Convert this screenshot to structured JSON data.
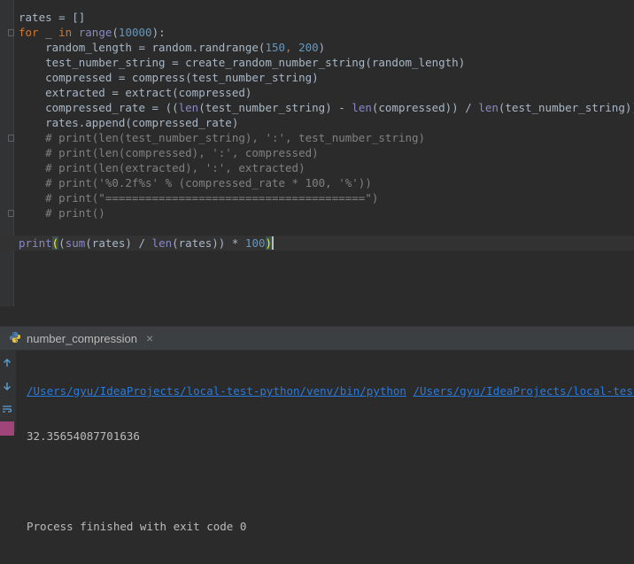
{
  "editor": {
    "lines": [
      [
        {
          "t": "rates = []",
          "c": ""
        }
      ],
      [
        {
          "t": "for",
          "c": "kw"
        },
        {
          "t": " _ ",
          "c": ""
        },
        {
          "t": "in",
          "c": "kw"
        },
        {
          "t": " ",
          "c": ""
        },
        {
          "t": "range",
          "c": "bi"
        },
        {
          "t": "(",
          "c": ""
        },
        {
          "t": "10000",
          "c": "num"
        },
        {
          "t": "):",
          "c": ""
        }
      ],
      [
        {
          "t": "    random_length = random.randrange(",
          "c": ""
        },
        {
          "t": "150",
          "c": "num"
        },
        {
          "t": ", ",
          "c": "kw"
        },
        {
          "t": "200",
          "c": "num"
        },
        {
          "t": ")",
          "c": ""
        }
      ],
      [
        {
          "t": "    test_number_string = create_random_number_string(random_length)",
          "c": ""
        }
      ],
      [
        {
          "t": "    compressed = compress(test_number_string)",
          "c": ""
        }
      ],
      [
        {
          "t": "    extracted = extract(compressed)",
          "c": ""
        }
      ],
      [
        {
          "t": "    compressed_rate = ((",
          "c": ""
        },
        {
          "t": "len",
          "c": "bi"
        },
        {
          "t": "(test_number_string) - ",
          "c": ""
        },
        {
          "t": "len",
          "c": "bi"
        },
        {
          "t": "(compressed)) / ",
          "c": ""
        },
        {
          "t": "len",
          "c": "bi"
        },
        {
          "t": "(test_number_string))",
          "c": ""
        }
      ],
      [
        {
          "t": "    rates.append(compressed_rate)",
          "c": ""
        }
      ],
      [
        {
          "t": "    # print(len(test_number_string), ':', test_number_string)",
          "c": "cm"
        }
      ],
      [
        {
          "t": "    # print(len(compressed), ':', compressed)",
          "c": "cm"
        }
      ],
      [
        {
          "t": "    # print(len(extracted), ':', extracted)",
          "c": "cm"
        }
      ],
      [
        {
          "t": "    # print('%0.2f%s' % (compressed_rate * 100, '%'))",
          "c": "cm"
        }
      ],
      [
        {
          "t": "    # print(\"=======================================\")",
          "c": "cm"
        }
      ],
      [
        {
          "t": "    # print()",
          "c": "cm"
        }
      ],
      [],
      [
        {
          "t": "print",
          "c": "bi"
        },
        {
          "t": "(",
          "c": "paren-hl"
        },
        {
          "t": "(",
          "c": ""
        },
        {
          "t": "sum",
          "c": "bi"
        },
        {
          "t": "(rates) / ",
          "c": ""
        },
        {
          "t": "len",
          "c": "bi"
        },
        {
          "t": "(rates)) * ",
          "c": ""
        },
        {
          "t": "100",
          "c": "num"
        },
        {
          "t": ")",
          "c": "paren-hl"
        }
      ]
    ]
  },
  "run_panel": {
    "tab_label": "number_compression",
    "tab_close": "×",
    "command_parts": [
      "/Users/gyu/IdeaProjects/local-test-python/venv/bin/python",
      " ",
      "/Users/gyu/IdeaProjects/local-test-py"
    ],
    "output": "32.35654087701636",
    "blank": "",
    "finish_message": "Process finished with exit code 0"
  },
  "icons": {
    "tab_icon": "python-icon",
    "up": "arrow-up-icon",
    "down": "arrow-down-icon",
    "wrap": "soft-wrap-icon"
  },
  "colors": {
    "background": "#2b2b2b",
    "keyword": "#cc7832",
    "builtin": "#8888c6",
    "number": "#6897bb",
    "comment": "#808080",
    "link": "#287bde",
    "bracket_highlight": "#ffef28"
  }
}
